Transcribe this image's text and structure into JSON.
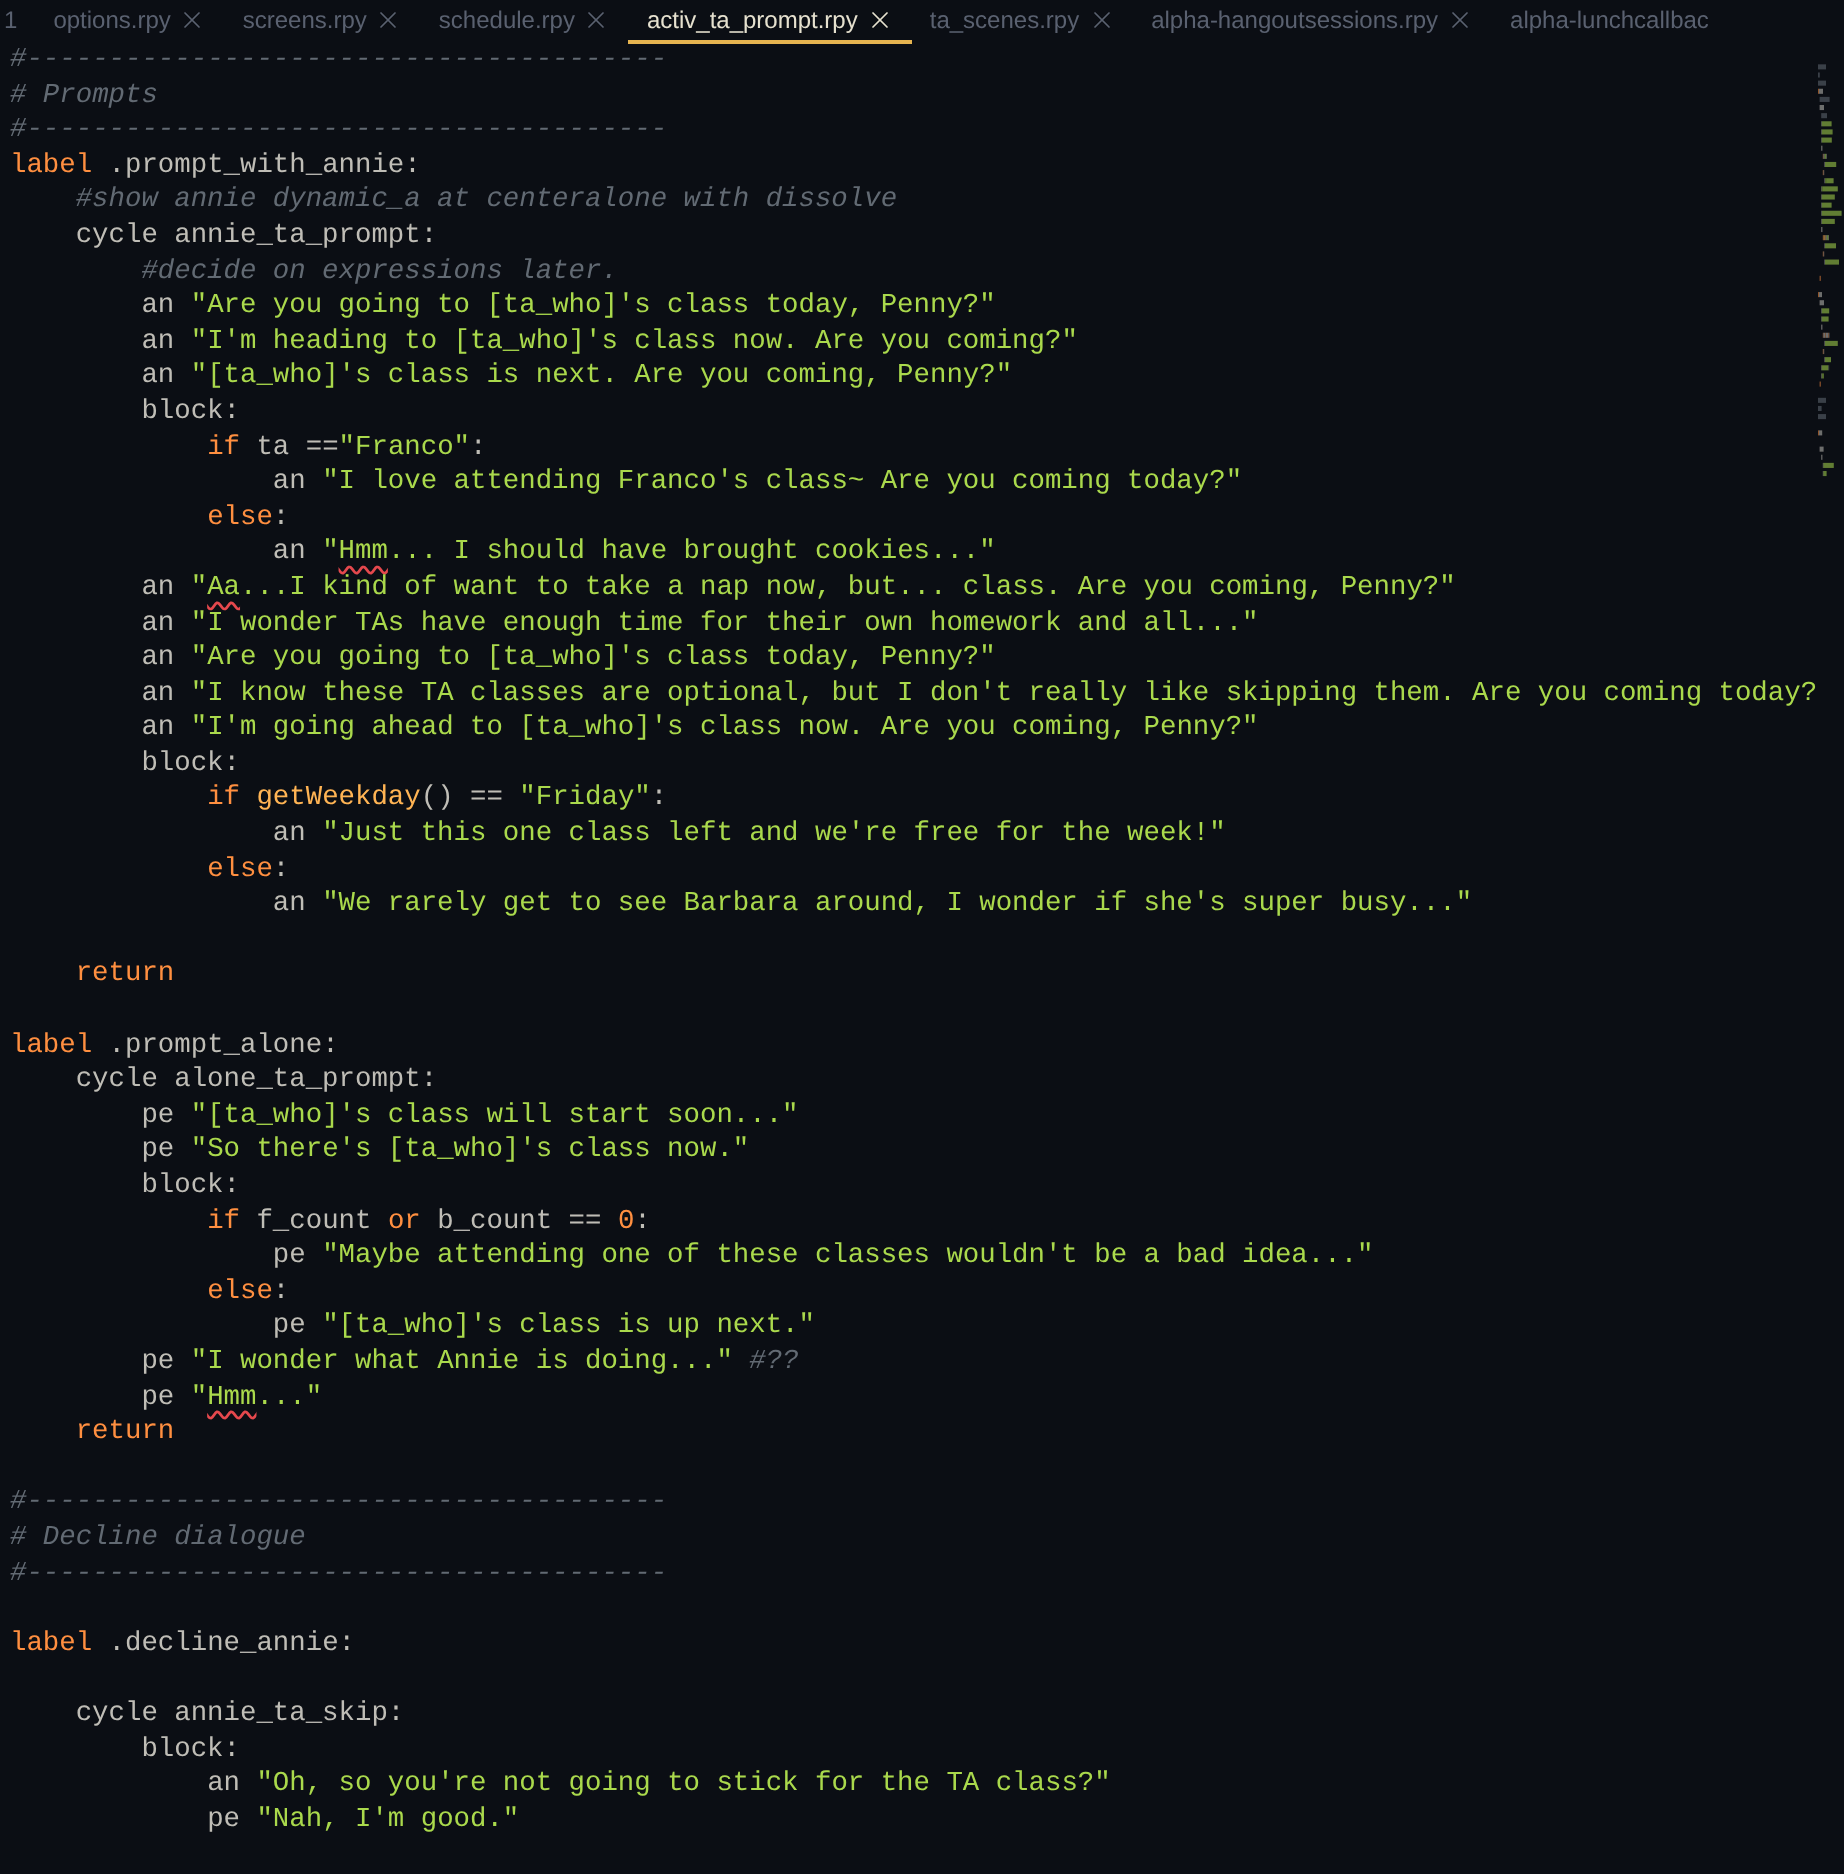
{
  "tabs": [
    {
      "label": "1",
      "selected": false,
      "closable": false
    },
    {
      "label": "options.rpy",
      "selected": false,
      "closable": true
    },
    {
      "label": "screens.rpy",
      "selected": false,
      "closable": true
    },
    {
      "label": "schedule.rpy",
      "selected": false,
      "closable": true
    },
    {
      "label": "activ_ta_prompt.rpy",
      "selected": true,
      "closable": true
    },
    {
      "label": "ta_scenes.rpy",
      "selected": false,
      "closable": true
    },
    {
      "label": "alpha-hangoutsessions.rpy",
      "selected": false,
      "closable": true
    },
    {
      "label": "alpha-lunchcallbac",
      "selected": false,
      "closable": false
    }
  ],
  "editor": {
    "lines": [
      {
        "kind": "code",
        "tokens": [
          {
            "kind": "comment",
            "text": "#---------------------------------------"
          }
        ]
      },
      {
        "kind": "code",
        "tokens": [
          {
            "kind": "comment",
            "text": "# Prompts"
          }
        ]
      },
      {
        "kind": "code",
        "tokens": [
          {
            "kind": "comment",
            "text": "#---------------------------------------"
          }
        ]
      },
      {
        "kind": "code",
        "tokens": [
          {
            "kind": "keyword",
            "text": "label"
          },
          {
            "kind": "plain",
            "text": " .prompt_with_annie:"
          }
        ],
        "children": [
          {
            "kind": "code",
            "tokens": [
              {
                "kind": "comment",
                "text": "#show annie dynamic_a at centeralone with dissolve"
              }
            ]
          },
          {
            "kind": "code",
            "tokens": [
              {
                "kind": "plain",
                "text": "cycle annie_ta_prompt:"
              }
            ],
            "children": [
              {
                "kind": "code",
                "tokens": [
                  {
                    "kind": "comment",
                    "text": "#decide on expressions later."
                  }
                ]
              },
              {
                "kind": "code",
                "tokens": [
                  {
                    "kind": "plain",
                    "text": "an "
                  },
                  {
                    "kind": "string",
                    "text": "\"Are you going to [ta_who]'s class today, Penny?\""
                  }
                ]
              },
              {
                "kind": "code",
                "tokens": [
                  {
                    "kind": "plain",
                    "text": "an "
                  },
                  {
                    "kind": "string",
                    "text": "\"I'm heading to [ta_who]'s class now. Are you coming?\""
                  }
                ]
              },
              {
                "kind": "code",
                "tokens": [
                  {
                    "kind": "plain",
                    "text": "an "
                  },
                  {
                    "kind": "string",
                    "text": "\"[ta_who]'s class is next. Are you coming, Penny?\""
                  }
                ]
              },
              {
                "kind": "code",
                "tokens": [
                  {
                    "kind": "plain",
                    "text": "block:"
                  }
                ],
                "children": [
                  {
                    "kind": "code",
                    "tokens": [
                      {
                        "kind": "keyword",
                        "text": "if"
                      },
                      {
                        "kind": "plain",
                        "text": " ta =="
                      },
                      {
                        "kind": "string",
                        "text": "\"Franco\""
                      },
                      {
                        "kind": "plain",
                        "text": ":"
                      }
                    ],
                    "children": [
                      {
                        "kind": "code",
                        "tokens": [
                          {
                            "kind": "plain",
                            "text": "an "
                          },
                          {
                            "kind": "string",
                            "text": "\"I love attending Franco's class~ Are you coming today?\""
                          }
                        ]
                      }
                    ]
                  },
                  {
                    "kind": "code",
                    "tokens": [
                      {
                        "kind": "keyword",
                        "text": "else"
                      },
                      {
                        "kind": "plain",
                        "text": ":"
                      }
                    ],
                    "children": [
                      {
                        "kind": "code",
                        "tokens": [
                          {
                            "kind": "plain",
                            "text": "an "
                          },
                          {
                            "kind": "string",
                            "text": "\""
                          },
                          {
                            "kind": "flagged",
                            "text": "Hmm"
                          },
                          {
                            "kind": "string",
                            "text": "... I should have brought cookies...\""
                          }
                        ]
                      }
                    ]
                  }
                ]
              },
              {
                "kind": "code",
                "tokens": [
                  {
                    "kind": "plain",
                    "text": "an "
                  },
                  {
                    "kind": "string",
                    "text": "\""
                  },
                  {
                    "kind": "flagged",
                    "text": "Aa"
                  },
                  {
                    "kind": "string",
                    "text": "...I kind of want to take a nap now, but... class. Are you coming, Penny?\""
                  }
                ]
              },
              {
                "kind": "code",
                "tokens": [
                  {
                    "kind": "plain",
                    "text": "an "
                  },
                  {
                    "kind": "string",
                    "text": "\"I wonder TAs have enough time for their own homework and all...\""
                  }
                ]
              },
              {
                "kind": "code",
                "tokens": [
                  {
                    "kind": "plain",
                    "text": "an "
                  },
                  {
                    "kind": "string",
                    "text": "\"Are you going to [ta_who]'s class today, Penny?\""
                  }
                ]
              },
              {
                "kind": "code",
                "tokens": [
                  {
                    "kind": "plain",
                    "text": "an "
                  },
                  {
                    "kind": "string",
                    "text": "\"I know these TA classes are optional, but I don't really like skipping them. Are you coming today?"
                  }
                ]
              },
              {
                "kind": "code",
                "tokens": [
                  {
                    "kind": "plain",
                    "text": "an "
                  },
                  {
                    "kind": "string",
                    "text": "\"I'm going ahead to [ta_who]'s class now. Are you coming, Penny?\""
                  }
                ]
              },
              {
                "kind": "code",
                "tokens": [
                  {
                    "kind": "plain",
                    "text": "block:"
                  }
                ],
                "children": [
                  {
                    "kind": "code",
                    "tokens": [
                      {
                        "kind": "keyword",
                        "text": "if"
                      },
                      {
                        "kind": "function",
                        "text": " getWeekday"
                      },
                      {
                        "kind": "plain",
                        "text": "() == "
                      },
                      {
                        "kind": "string",
                        "text": "\"Friday\""
                      },
                      {
                        "kind": "plain",
                        "text": ":"
                      }
                    ],
                    "children": [
                      {
                        "kind": "code",
                        "tokens": [
                          {
                            "kind": "plain",
                            "text": "an "
                          },
                          {
                            "kind": "string",
                            "text": "\"Just this one class left and we're free for the week!\""
                          }
                        ]
                      }
                    ]
                  },
                  {
                    "kind": "code",
                    "tokens": [
                      {
                        "kind": "keyword",
                        "text": "else"
                      },
                      {
                        "kind": "plain",
                        "text": ":"
                      }
                    ],
                    "children": [
                      {
                        "kind": "code",
                        "tokens": [
                          {
                            "kind": "plain",
                            "text": "an "
                          },
                          {
                            "kind": "string",
                            "text": "\"We rarely get to see Barbara around, I wonder if she's super busy...\""
                          }
                        ]
                      }
                    ]
                  }
                ]
              }
            ]
          },
          {
            "kind": "blank"
          },
          {
            "kind": "code",
            "tokens": [
              {
                "kind": "keyword",
                "text": "return"
              }
            ]
          }
        ]
      },
      {
        "kind": "blank"
      },
      {
        "kind": "code",
        "tokens": [
          {
            "kind": "keyword",
            "text": "label"
          },
          {
            "kind": "plain",
            "text": " .prompt_alone:"
          }
        ],
        "children": [
          {
            "kind": "code",
            "tokens": [
              {
                "kind": "plain",
                "text": "cycle alone_ta_prompt:"
              }
            ],
            "children": [
              {
                "kind": "code",
                "tokens": [
                  {
                    "kind": "plain",
                    "text": "pe "
                  },
                  {
                    "kind": "string",
                    "text": "\"[ta_who]'s class will start soon...\""
                  }
                ]
              },
              {
                "kind": "code",
                "tokens": [
                  {
                    "kind": "plain",
                    "text": "pe "
                  },
                  {
                    "kind": "string",
                    "text": "\"So there's [ta_who]'s class now.\""
                  }
                ]
              },
              {
                "kind": "code",
                "tokens": [
                  {
                    "kind": "plain",
                    "text": "block:"
                  }
                ],
                "children": [
                  {
                    "kind": "code",
                    "tokens": [
                      {
                        "kind": "keyword",
                        "text": "if"
                      },
                      {
                        "kind": "plain",
                        "text": " f_count "
                      },
                      {
                        "kind": "keyword",
                        "text": "or"
                      },
                      {
                        "kind": "plain",
                        "text": " b_count == "
                      },
                      {
                        "kind": "number",
                        "text": "0"
                      },
                      {
                        "kind": "plain",
                        "text": ":"
                      }
                    ],
                    "children": [
                      {
                        "kind": "code",
                        "tokens": [
                          {
                            "kind": "plain",
                            "text": "pe "
                          },
                          {
                            "kind": "string",
                            "text": "\"Maybe attending one of these classes wouldn't be a bad idea...\""
                          }
                        ]
                      }
                    ]
                  },
                  {
                    "kind": "code",
                    "tokens": [
                      {
                        "kind": "keyword",
                        "text": "else"
                      },
                      {
                        "kind": "plain",
                        "text": ":"
                      }
                    ],
                    "children": [
                      {
                        "kind": "code",
                        "tokens": [
                          {
                            "kind": "plain",
                            "text": "pe "
                          },
                          {
                            "kind": "string",
                            "text": "\"[ta_who]'s class is up next.\""
                          }
                        ]
                      }
                    ]
                  }
                ]
              },
              {
                "kind": "code",
                "tokens": [
                  {
                    "kind": "plain",
                    "text": "pe "
                  },
                  {
                    "kind": "string",
                    "text": "\"I wonder what Annie is doing...\""
                  },
                  {
                    "kind": "comment",
                    "text": " #??"
                  }
                ]
              },
              {
                "kind": "code",
                "tokens": [
                  {
                    "kind": "plain",
                    "text": "pe "
                  },
                  {
                    "kind": "string",
                    "text": "\""
                  },
                  {
                    "kind": "flagged",
                    "text": "Hmm"
                  },
                  {
                    "kind": "string",
                    "text": "...\""
                  }
                ]
              }
            ]
          },
          {
            "kind": "code",
            "tokens": [
              {
                "kind": "keyword",
                "text": "return"
              }
            ]
          }
        ]
      },
      {
        "kind": "blank"
      },
      {
        "kind": "code",
        "tokens": [
          {
            "kind": "comment",
            "text": "#---------------------------------------"
          }
        ]
      },
      {
        "kind": "code",
        "tokens": [
          {
            "kind": "comment",
            "text": "# Decline dialogue"
          }
        ]
      },
      {
        "kind": "code",
        "tokens": [
          {
            "kind": "comment",
            "text": "#---------------------------------------"
          }
        ]
      },
      {
        "kind": "blank"
      },
      {
        "kind": "code",
        "tokens": [
          {
            "kind": "keyword",
            "text": "label"
          },
          {
            "kind": "plain",
            "text": " .decline_annie:"
          }
        ],
        "children": [
          {
            "kind": "blank"
          },
          {
            "kind": "code",
            "tokens": [
              {
                "kind": "plain",
                "text": "cycle annie_ta_skip:"
              }
            ],
            "children": [
              {
                "kind": "code",
                "tokens": [
                  {
                    "kind": "plain",
                    "text": "block:"
                  }
                ],
                "children": [
                  {
                    "kind": "code",
                    "tokens": [
                      {
                        "kind": "plain",
                        "text": "an "
                      },
                      {
                        "kind": "string",
                        "text": "\"Oh, so you're not going to stick for the TA class?\""
                      }
                    ]
                  },
                  {
                    "kind": "code",
                    "tokens": [
                      {
                        "kind": "plain",
                        "text": "pe "
                      },
                      {
                        "kind": "string",
                        "text": "\"Nah, I'm good.\""
                      }
                    ]
                  }
                ]
              }
            ]
          }
        ]
      }
    ]
  }
}
